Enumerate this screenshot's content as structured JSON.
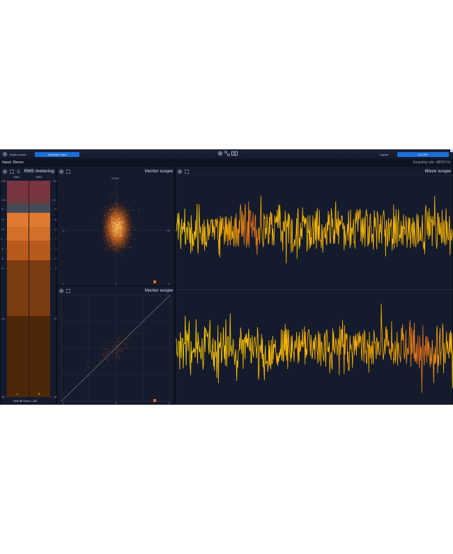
{
  "topbar": {
    "audio_source_label": "Audio source",
    "audio_source_value": "Hardware input",
    "layout_label": "Layout",
    "layout_value": "SCOPE"
  },
  "subbar": {
    "input_label": "Input: Stereo",
    "sampling_rate": "Sampling rate: 48000 Hz"
  },
  "rms": {
    "title": "RMS metering",
    "peak_left": "+10.1",
    "peak_right": "+10.2",
    "scale_labels": [
      "+18",
      "+12",
      "+9",
      "+6",
      "+3",
      "0",
      "-3",
      "-6",
      "-9",
      "-24",
      "-48"
    ],
    "channel_left": "L",
    "channel_right": "R",
    "footer": "RMS  dB  Short  s  -183"
  },
  "vector_top": {
    "title": "Vector scope",
    "mono_label": "MONO",
    "left_tick": "+L",
    "right_tick": "+R",
    "bottom_left": "-1",
    "bottom_mid": "0",
    "bottom_right": "+1"
  },
  "vector_bottom": {
    "title": "Vector scope",
    "bottom_left": "-1",
    "bottom_mid": "0",
    "bottom_right": "+1"
  },
  "wave": {
    "title": "Wave scope"
  },
  "colors": {
    "accent_blue": "#1d6fd8",
    "background": "#0f1626",
    "panel": "#141b2d",
    "wave_yellow": "#f5b400",
    "wave_orange": "#e06a1a"
  },
  "icons": [
    "gear-icon",
    "expand-icon",
    "refresh-icon",
    "layout-icon",
    "screenshot-icon"
  ]
}
